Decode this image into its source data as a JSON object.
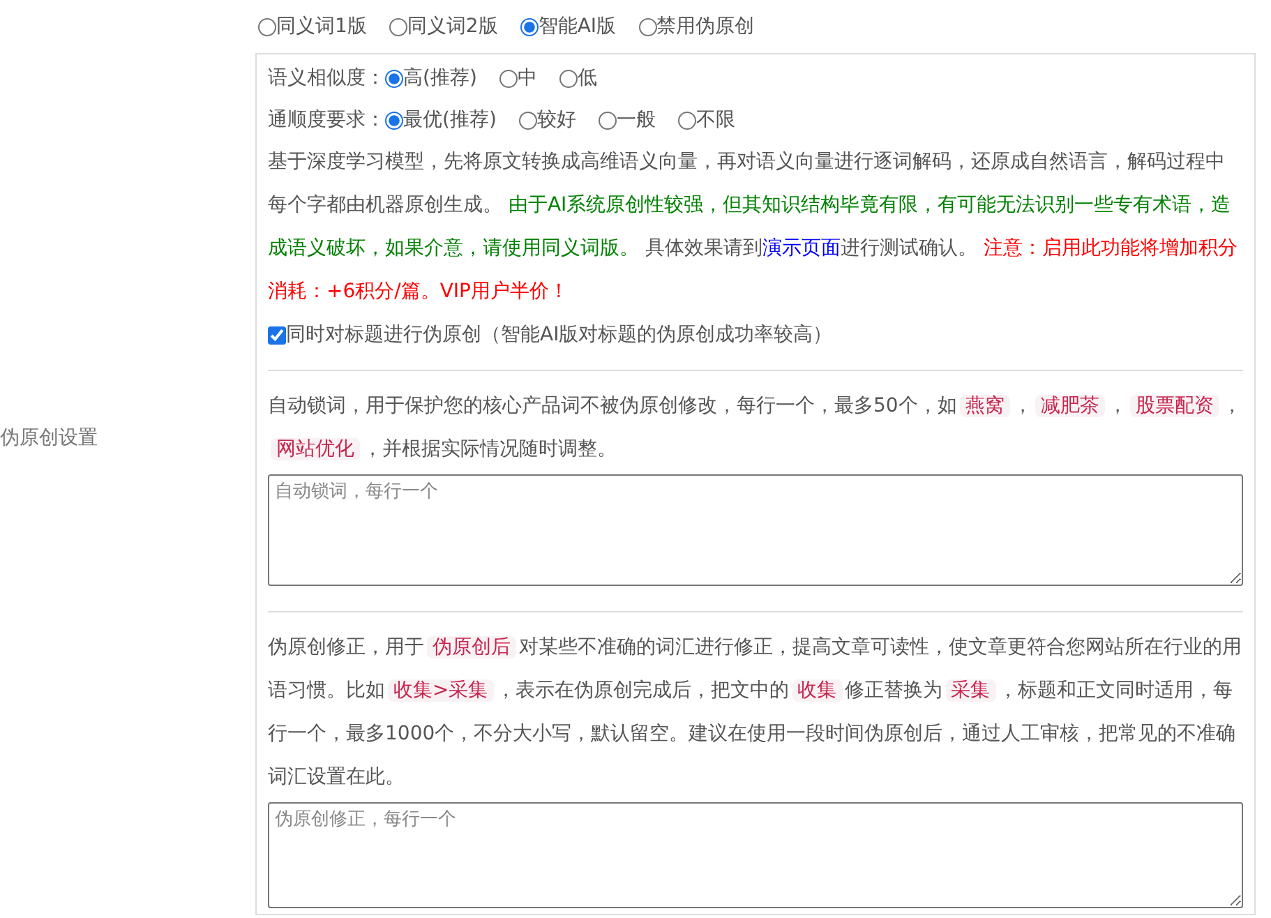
{
  "version_options": [
    {
      "label": "同义词1版",
      "selected": false
    },
    {
      "label": "同义词2版",
      "selected": false
    },
    {
      "label": "智能AI版",
      "selected": true
    },
    {
      "label": "禁用伪原创",
      "selected": false
    }
  ],
  "settings_label": "伪原创设置",
  "ai_panel": {
    "similarity": {
      "label": "语义相似度：",
      "options": [
        {
          "label": "高(推荐)",
          "selected": true
        },
        {
          "label": "中",
          "selected": false
        },
        {
          "label": "低",
          "selected": false
        }
      ]
    },
    "fluency": {
      "label": "通顺度要求：",
      "options": [
        {
          "label": "最优(推荐)",
          "selected": true
        },
        {
          "label": "较好",
          "selected": false
        },
        {
          "label": "一般",
          "selected": false
        },
        {
          "label": "不限",
          "selected": false
        }
      ]
    },
    "description": [
      {
        "kind": "text",
        "text": "基于深度学习模型，先将原文转换成高维语义向量，再对语义向量进行逐词解码，还原成自然语言，解码过程中每个字都由机器原创生成。 "
      },
      {
        "kind": "green",
        "text": "由于AI系统原创性较强，但其知识结构毕竟有限，有可能无法识别一些专有术语，造成语义破坏，如果介意，请使用同义词版。"
      },
      {
        "kind": "text",
        "text": " 具体效果请到"
      },
      {
        "kind": "link",
        "text": "演示页面"
      },
      {
        "kind": "text",
        "text": "进行测试确认。 "
      },
      {
        "kind": "red",
        "text": "注意：启用此功能将增加积分消耗：+6积分/篇。VIP用户半价！"
      }
    ],
    "title_option": {
      "label": "同时对标题进行伪原创（智能AI版对标题的伪原创成功率较高）",
      "checked": true
    }
  },
  "lock_words": {
    "description": [
      {
        "kind": "text",
        "text": "自动锁词，用于保护您的核心产品词不被伪原创修改，每行一个，最多50个，如"
      },
      {
        "kind": "tag",
        "text": "燕窝"
      },
      {
        "kind": "text",
        "text": "，"
      },
      {
        "kind": "tag",
        "text": "减肥茶"
      },
      {
        "kind": "text",
        "text": "，"
      },
      {
        "kind": "tag",
        "text": "股票配资"
      },
      {
        "kind": "text",
        "text": "，"
      },
      {
        "kind": "tag",
        "text": "网站优化"
      },
      {
        "kind": "text",
        "text": "，并根据实际情况随时调整。"
      }
    ],
    "placeholder": "自动锁词，每行一个"
  },
  "correction": {
    "description": [
      {
        "kind": "text",
        "text": "伪原创修正，用于"
      },
      {
        "kind": "tag",
        "text": "伪原创后"
      },
      {
        "kind": "text",
        "text": "对某些不准确的词汇进行修正，提高文章可读性，使文章更符合您网站所在行业的用语习惯。比如"
      },
      {
        "kind": "tag",
        "text": "收集>采集"
      },
      {
        "kind": "text",
        "text": "，表示在伪原创完成后，把文中的"
      },
      {
        "kind": "tag",
        "text": "收集"
      },
      {
        "kind": "text",
        "text": "修正替换为"
      },
      {
        "kind": "tag",
        "text": "采集"
      },
      {
        "kind": "text",
        "text": "，标题和正文同时适用，每行一个，最多1000个，不分大小写，默认留空。建议在使用一段时间伪原创后，通过人工审核，把常见的不准确词汇设置在此。"
      }
    ],
    "placeholder": "伪原创修正，每行一个"
  }
}
